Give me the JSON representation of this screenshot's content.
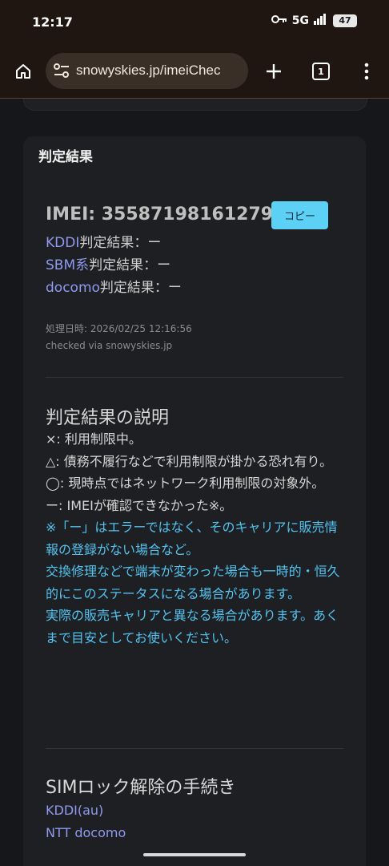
{
  "status_bar": {
    "time": "12:17",
    "network": "5G",
    "battery": "47",
    "icons": [
      "key-icon",
      "signal-icon",
      "battery-icon"
    ]
  },
  "browser": {
    "url": "snowyskies.jp/imeiChec",
    "tab_count": "1",
    "icons": [
      "home-icon",
      "site-settings-icon",
      "new-tab-icon",
      "tabs-icon",
      "more-icon"
    ]
  },
  "result": {
    "header": "判定結果",
    "imei_line": "IMEI: 355871981612794",
    "copy_label": "コピー",
    "carriers": [
      {
        "name": "KDDI",
        "result": "判定結果：ー"
      },
      {
        "name": "SBM系",
        "result": "判定結果：ー"
      },
      {
        "name": "docomo",
        "result": "判定結果：ー"
      }
    ],
    "processed": "処理日時: 2026/02/25 12:16:56",
    "checked_via": "checked via snowyskies.jp"
  },
  "explanation": {
    "title": "判定結果の説明",
    "lines": [
      "×: 利用制限中。",
      "△: 債務不履行などで利用制限が掛かる恐れ有り。",
      "◯: 現時点ではネットワーク利用制限の対象外。",
      "ー: IMEIが確認できなかった※。"
    ],
    "notes": [
      "※「ー」はエラーではなく、そのキャリアに販売情報の登録がない場合など。",
      "交換修理などで端末が変わった場合も一時的・恒久的にこのステータスになる場合があります。",
      "実際の販売キャリアと異なる場合があります。あくまで目安としてお使いください。"
    ]
  },
  "sim_unlock": {
    "title": "SIMロック解除の手続き",
    "links": [
      "KDDI(au)",
      "NTT docomo"
    ]
  },
  "colors": {
    "link": "#8f9af0",
    "note": "#52c3f0",
    "copy_button": "#5cd0f5",
    "toolbar": "#1f1611"
  }
}
